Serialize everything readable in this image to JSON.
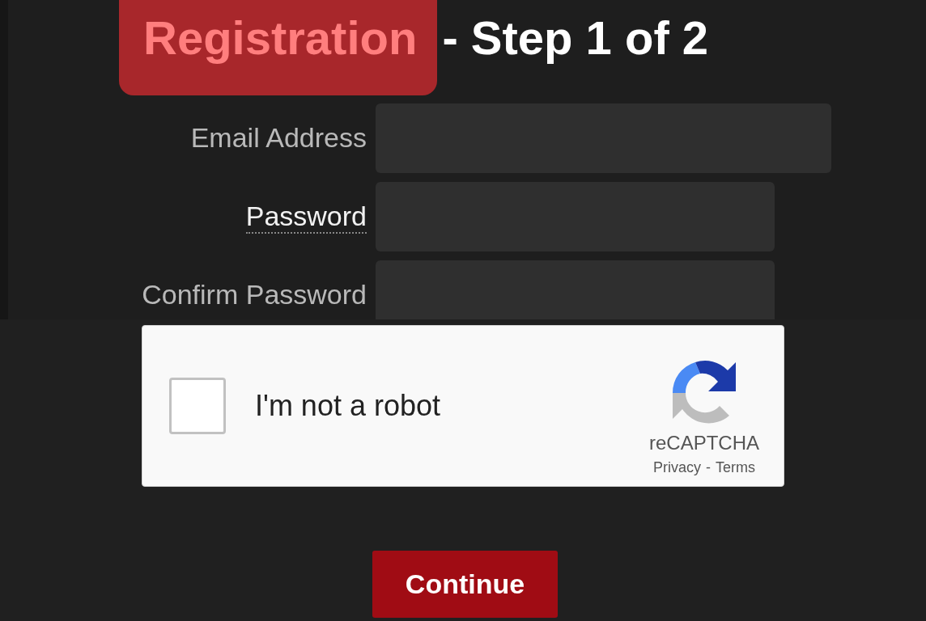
{
  "title": [
    {
      "text": "Registration",
      "highlighted": true
    },
    {
      "text": "- Step 1 of 2",
      "highlighted": false
    }
  ],
  "fields": [
    {
      "label": "Email Address",
      "kind": "email",
      "has_tooltip": false
    },
    {
      "label": "Password",
      "kind": "password",
      "has_tooltip": true
    },
    {
      "label": "Confirm Password",
      "kind": "password",
      "has_tooltip": false
    }
  ],
  "captcha": {
    "checked": false,
    "label": "I'm not a robot",
    "brand": "reCAPTCHA",
    "links": [
      "Privacy",
      "Terms"
    ],
    "separator": "-"
  },
  "button": "Continue"
}
